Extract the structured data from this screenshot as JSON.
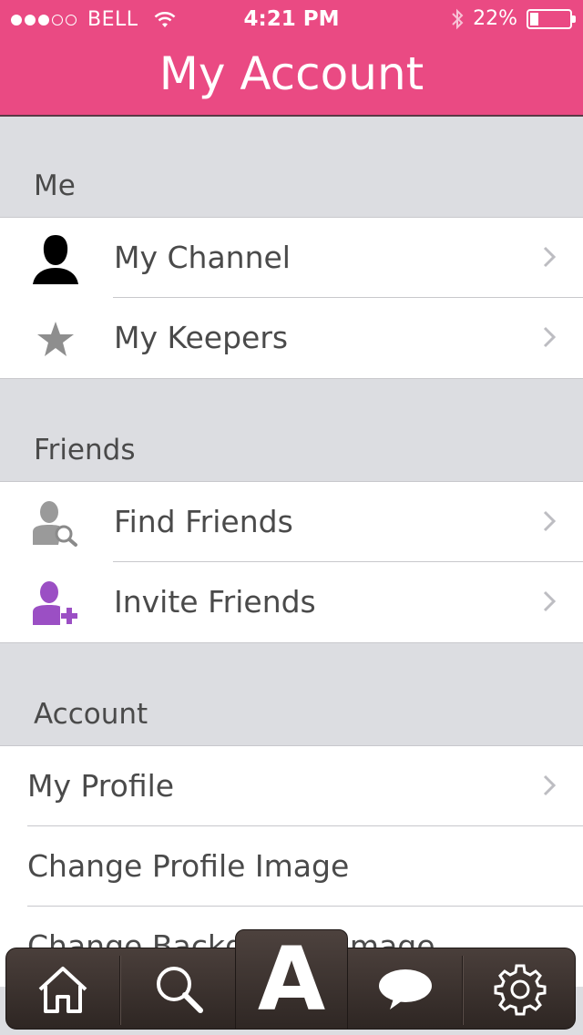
{
  "status": {
    "carrier": "BELL",
    "time": "4:21 PM",
    "battery": "22%",
    "battery_level": 0.22
  },
  "header": {
    "title": "My Account"
  },
  "sections": {
    "me": {
      "title": "Me",
      "items": [
        "My Channel",
        "My Keepers"
      ]
    },
    "friends": {
      "title": "Friends",
      "items": [
        "Find Friends",
        "Invite Friends"
      ]
    },
    "account": {
      "title": "Account",
      "items": [
        "My Profile",
        "Change Profile Image",
        "Change Background Image"
      ]
    }
  },
  "tabbar": {
    "center_label": "A",
    "icons": [
      "home-icon",
      "search-icon",
      "app-logo",
      "chat-icon",
      "settings-icon"
    ]
  },
  "colors": {
    "accent": "#ea4a83",
    "purple": "#9b4fc4"
  }
}
